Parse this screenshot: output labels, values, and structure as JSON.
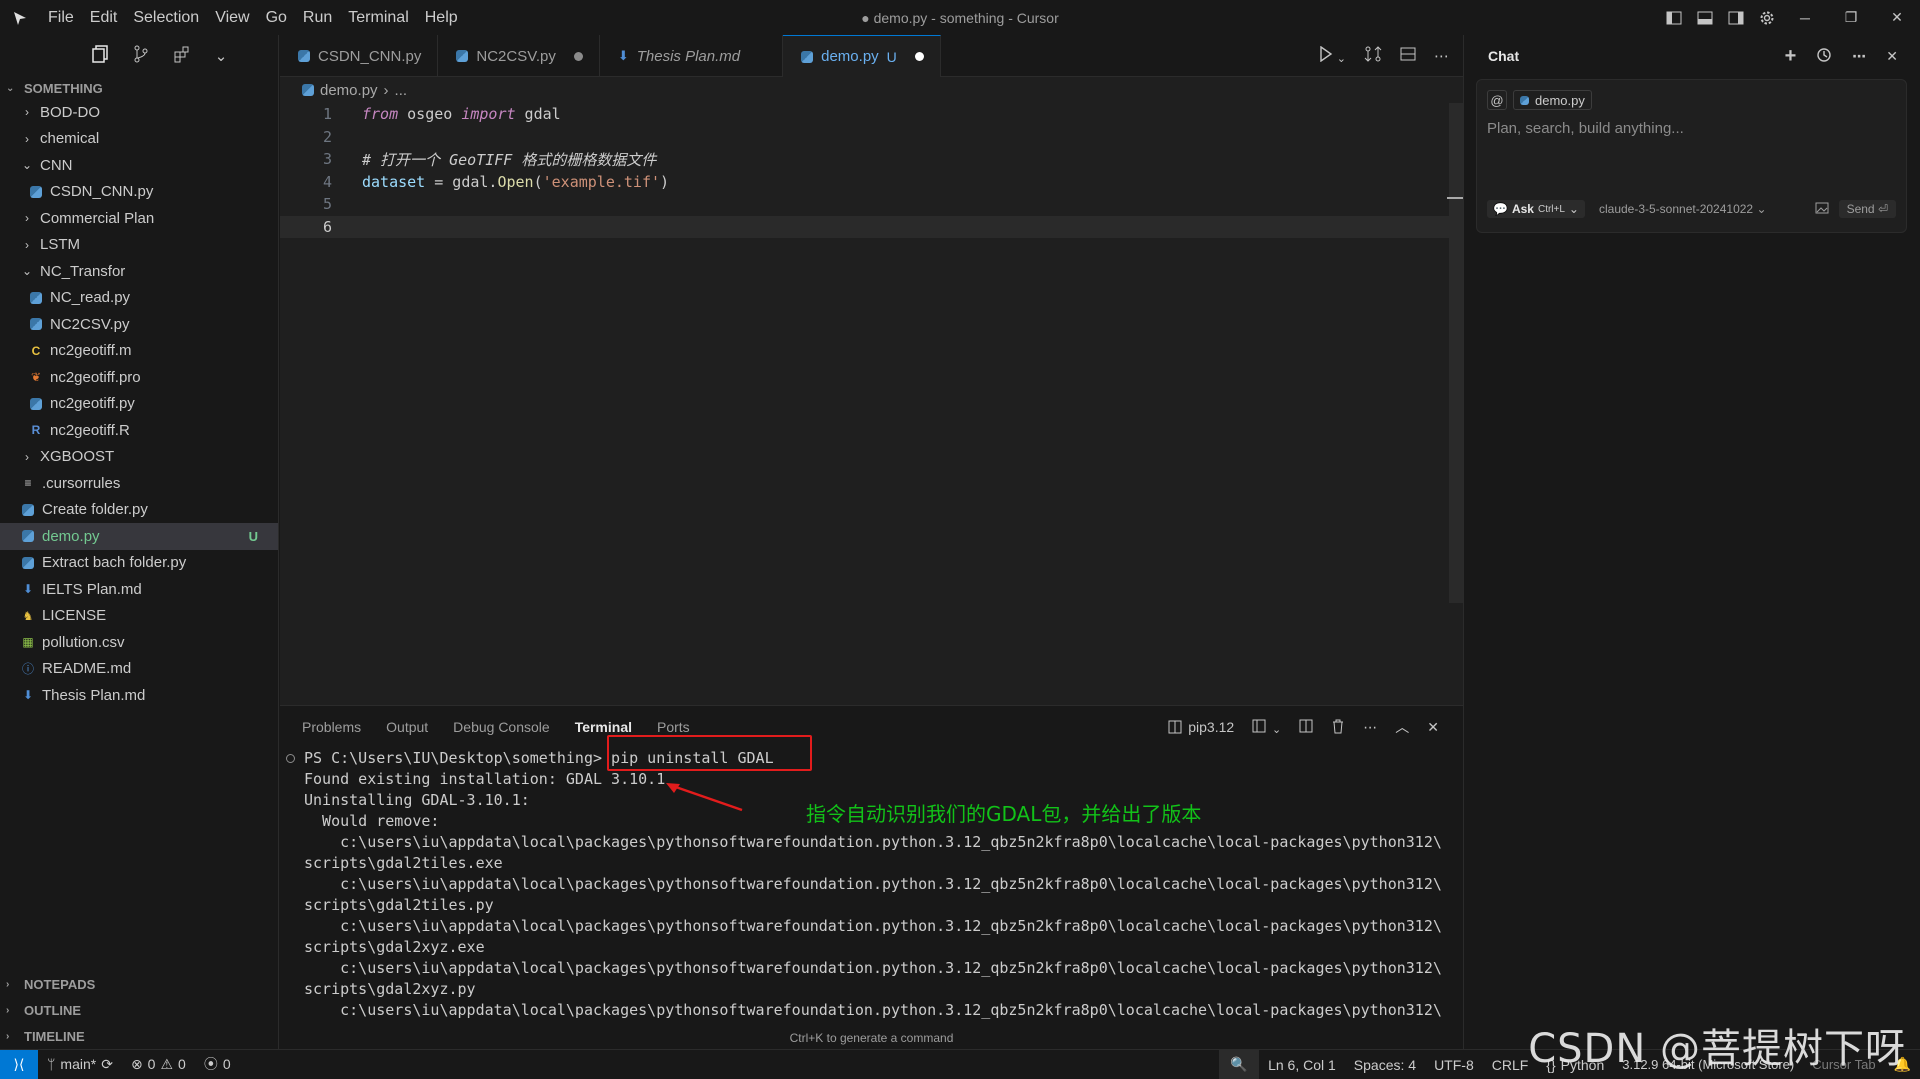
{
  "window": {
    "title": "● demo.py - something - Cursor"
  },
  "menu": [
    "File",
    "Edit",
    "Selection",
    "View",
    "Go",
    "Run",
    "Terminal",
    "Help"
  ],
  "explorer": {
    "section": "SOMETHING",
    "items": [
      {
        "label": "BOD-DO",
        "kind": "folder",
        "state": "closed",
        "depth": 0
      },
      {
        "label": "chemical",
        "kind": "folder",
        "state": "closed",
        "depth": 0
      },
      {
        "label": "CNN",
        "kind": "folder",
        "state": "open",
        "depth": 0
      },
      {
        "label": "CSDN_CNN.py",
        "kind": "py",
        "depth": 1
      },
      {
        "label": "Commercial Plan",
        "kind": "folder",
        "state": "closed",
        "depth": 0
      },
      {
        "label": "LSTM",
        "kind": "folder",
        "state": "closed",
        "depth": 0
      },
      {
        "label": "NC_Transfor",
        "kind": "folder",
        "state": "open",
        "depth": 0
      },
      {
        "label": "NC_read.py",
        "kind": "py",
        "depth": 1
      },
      {
        "label": "NC2CSV.py",
        "kind": "py",
        "depth": 1
      },
      {
        "label": "nc2geotiff.m",
        "kind": "m",
        "depth": 1
      },
      {
        "label": "nc2geotiff.pro",
        "kind": "pro",
        "depth": 1
      },
      {
        "label": "nc2geotiff.py",
        "kind": "py",
        "depth": 1
      },
      {
        "label": "nc2geotiff.R",
        "kind": "r",
        "depth": 1
      },
      {
        "label": "XGBOOST",
        "kind": "folder",
        "state": "closed",
        "depth": 0
      },
      {
        "label": ".cursorrules",
        "kind": "txt",
        "depth": 0
      },
      {
        "label": "Create folder.py",
        "kind": "py",
        "depth": 0
      },
      {
        "label": "demo.py",
        "kind": "py",
        "depth": 0,
        "selected": true,
        "badge": "U"
      },
      {
        "label": "Extract bach folder.py",
        "kind": "py",
        "depth": 0
      },
      {
        "label": "IELTS Plan.md",
        "kind": "md",
        "depth": 0
      },
      {
        "label": "LICENSE",
        "kind": "lic",
        "depth": 0
      },
      {
        "label": "pollution.csv",
        "kind": "csv",
        "depth": 0
      },
      {
        "label": "README.md",
        "kind": "info",
        "depth": 0
      },
      {
        "label": "Thesis Plan.md",
        "kind": "md",
        "depth": 0
      }
    ],
    "bottom_sections": [
      "NOTEPADS",
      "OUTLINE",
      "TIMELINE"
    ]
  },
  "tabs": [
    {
      "label": "CSDN_CNN.py",
      "icon": "py"
    },
    {
      "label": "NC2CSV.py",
      "icon": "py",
      "dirty": true
    },
    {
      "label": "Thesis Plan.md",
      "icon": "md",
      "italic": true
    },
    {
      "label": "demo.py",
      "icon": "py",
      "badge": "U",
      "dirty": true,
      "active": true
    }
  ],
  "breadcrumb": {
    "file": "demo.py",
    "rest": "..."
  },
  "editor": {
    "lines": [
      {
        "n": "1"
      },
      {
        "n": "2"
      },
      {
        "n": "3"
      },
      {
        "n": "4"
      },
      {
        "n": "5"
      },
      {
        "n": "6"
      }
    ],
    "line1": {
      "kw1": "from",
      "mod": " osgeo ",
      "kw2": "import",
      "name": " gdal"
    },
    "line3": {
      "comment": "# 打开一个 GeoTIFF 格式的栅格数据文件"
    },
    "line4": {
      "var": "dataset",
      "eq": " = gdal.",
      "fn": "Open",
      "p1": "(",
      "str": "'example.tif'",
      "p2": ")"
    }
  },
  "panel": {
    "tabs": [
      "Problems",
      "Output",
      "Debug Console",
      "Terminal",
      "Ports"
    ],
    "active_tab": "Terminal",
    "shell": "pip3.12",
    "hint": "Ctrl+K to generate a command"
  },
  "terminal": {
    "prompt": "PS C:\\Users\\IU\\Desktop\\something> ",
    "command": "pip uninstall GDAL",
    "lines": [
      "Found existing installation: GDAL 3.10.1",
      "Uninstalling GDAL-3.10.1:",
      "  Would remove:",
      "    c:\\users\\iu\\appdata\\local\\packages\\pythonsoftwarefoundation.python.3.12_qbz5n2kfra8p0\\localcache\\local-packages\\python312\\",
      "scripts\\gdal2tiles.exe",
      "    c:\\users\\iu\\appdata\\local\\packages\\pythonsoftwarefoundation.python.3.12_qbz5n2kfra8p0\\localcache\\local-packages\\python312\\",
      "scripts\\gdal2tiles.py",
      "    c:\\users\\iu\\appdata\\local\\packages\\pythonsoftwarefoundation.python.3.12_qbz5n2kfra8p0\\localcache\\local-packages\\python312\\",
      "scripts\\gdal2xyz.exe",
      "    c:\\users\\iu\\appdata\\local\\packages\\pythonsoftwarefoundation.python.3.12_qbz5n2kfra8p0\\localcache\\local-packages\\python312\\",
      "scripts\\gdal2xyz.py",
      "    c:\\users\\iu\\appdata\\local\\packages\\pythonsoftwarefoundation.python.3.12_qbz5n2kfra8p0\\localcache\\local-packages\\python312\\"
    ],
    "annotation": "指令自动识别我们的GDAL包，并给出了版本",
    "annotation_color": "#12c218",
    "highlight_color": "#e21c1c"
  },
  "chat": {
    "title": "Chat",
    "context_file": "demo.py",
    "placeholder": "Plan, search, build anything...",
    "mode": "Ask",
    "mode_shortcut": "Ctrl+L",
    "model": "claude-3-5-sonnet-20241022",
    "send": "Send"
  },
  "status": {
    "branch": "main*",
    "errors": "0",
    "warnings": "0",
    "ports": "0",
    "position": "Ln 6, Col 1",
    "spaces": "Spaces: 4",
    "encoding": "UTF-8",
    "eol": "CRLF",
    "language": "Python",
    "interpreter": "3.12.9 64-bit (Microsoft Store)",
    "cursor_tab": "Cursor Tab"
  },
  "watermark": "CSDN @菩提树下呀",
  "colors": {
    "accent": "#0078d4",
    "modified": "#73c991"
  }
}
